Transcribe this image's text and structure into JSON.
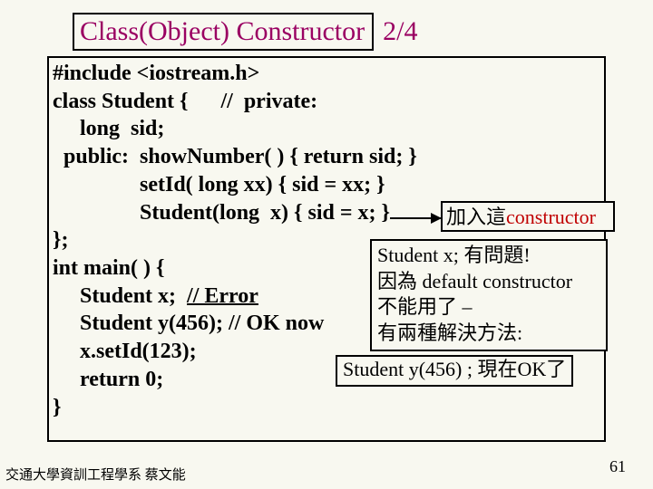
{
  "title": {
    "main": "Class(Object) Constructor",
    "suffix": "2/4"
  },
  "code": {
    "l1": "#include <iostream.h>",
    "l2": "class Student {      //  private:",
    "l3": "     long  sid;",
    "l4": "  public:  showNumber( ) { return sid; }",
    "l5": "                setId( long xx) { sid = xx; }",
    "l6": "                Student(long  x) { sid = x; }",
    "l7": "};",
    "l8": "int main( ) {",
    "l9a": "     Student x;  ",
    "l9b": "// Error",
    "l10": "     Student y(456); // OK now",
    "l11": "     x.setId(123);",
    "l12": "     return 0;",
    "l13": "}"
  },
  "callout1": {
    "text1": "加入這",
    "text2": "constructor"
  },
  "callout2": {
    "l1": "Student x;  有問題!",
    "l2": "因為 default constructor",
    "l3": "不能用了 –",
    "l4": "有兩種解決方法:"
  },
  "callout3": "Student y(456) ;  現在OK了",
  "footer": "交通大學資訓工程學系 蔡文能",
  "pagenum": "61"
}
